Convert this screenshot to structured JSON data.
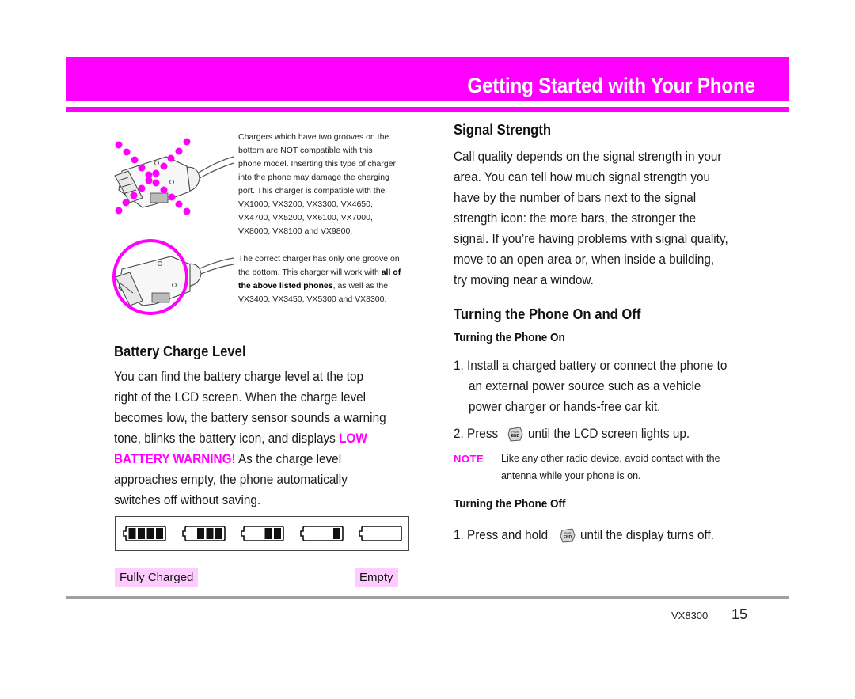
{
  "header": {
    "title": "Getting Started with Your Phone",
    "accent_color": "#ff00ff"
  },
  "charger_info": {
    "incompatible_caption": "Chargers which have two grooves on the bottom are NOT compatible with this phone model. Inserting this type of charger into the phone may damage the charging port. This charger is compatible with the VX1000, VX3200, VX3300, VX4650, VX4700, VX5200, VX6100, VX7000, VX8000, VX8100 and VX9800.",
    "incompatible_lines": [
      "Chargers which have two grooves on the",
      "bottom are NOT compatible with this",
      "phone model. Inserting this type of charger",
      "into the phone may damage the charging",
      "port. This charger is compatible with the",
      "VX1000, VX3200, VX3300, VX4650,",
      "VX4700, VX5200, VX6100, VX7000,",
      "VX8000, VX8100 and VX9800."
    ],
    "correct_line1": "The correct charger has only one groove on",
    "correct_line2_pre": "the bottom. This charger will work with ",
    "correct_line2_bold": "all of",
    "correct_line3_bold": "the above listed phones",
    "correct_line3_post": ", as well as the",
    "correct_line4": "VX3400, VX3450, VX5300 and VX8300.",
    "incompatible_icon": "charger-two-grooves-crossed-icon",
    "correct_icon": "charger-one-groove-circled-icon"
  },
  "battery": {
    "heading": "Battery Charge Level",
    "lines": [
      "You can find the battery charge level at the top",
      "right of the LCD screen. When the charge level",
      "becomes low, the battery sensor sounds a warning"
    ],
    "line4_pre": "tone, blinks the battery icon, and displays ",
    "line4_pink": "LOW",
    "line5_pink": "BATTERY WARNING!",
    "line5_post": " As the charge level",
    "line6": "approaches empty, the phone automatically",
    "line7": "switches off without saving.",
    "levels": [
      {
        "bars": 4,
        "max": 4
      },
      {
        "bars": 3,
        "max": 4
      },
      {
        "bars": 2,
        "max": 4
      },
      {
        "bars": 1,
        "max": 4
      },
      {
        "bars": 0,
        "max": 4
      }
    ],
    "label_full": "Fully Charged",
    "label_empty": "Empty"
  },
  "signal": {
    "heading": "Signal Strength",
    "lines": [
      "Call quality depends on the signal strength in your",
      "area. You can tell how much signal strength you",
      "have by the number of bars next to the signal",
      "strength icon: the more bars, the stronger the",
      "signal. If you’re having problems with signal quality,",
      "move to an open area or, when inside a building,",
      "try moving near a window."
    ]
  },
  "power": {
    "heading": "Turning the Phone On and Off",
    "on_heading": "Turning the Phone On",
    "on_step1_lines": [
      "1. Install a charged battery or connect the phone to",
      "an external power source such as a vehicle",
      "power charger or hands-free car kit."
    ],
    "on_step2_pre": "2. Press",
    "on_step2_post": "until the LCD screen lights up.",
    "note_label": "NOTE",
    "note_lines": [
      "Like any other radio device, avoid contact with the",
      "antenna while your phone is on."
    ],
    "off_heading": "Turning the Phone Off",
    "off_step1_pre": "1.  Press and hold",
    "off_step1_post": "until the display turns off.",
    "key_icon": "pwr-end-key-icon",
    "key_text_top": "PWR",
    "key_text_bottom": "END"
  },
  "footer": {
    "model": "VX8300",
    "page_number": "15"
  }
}
